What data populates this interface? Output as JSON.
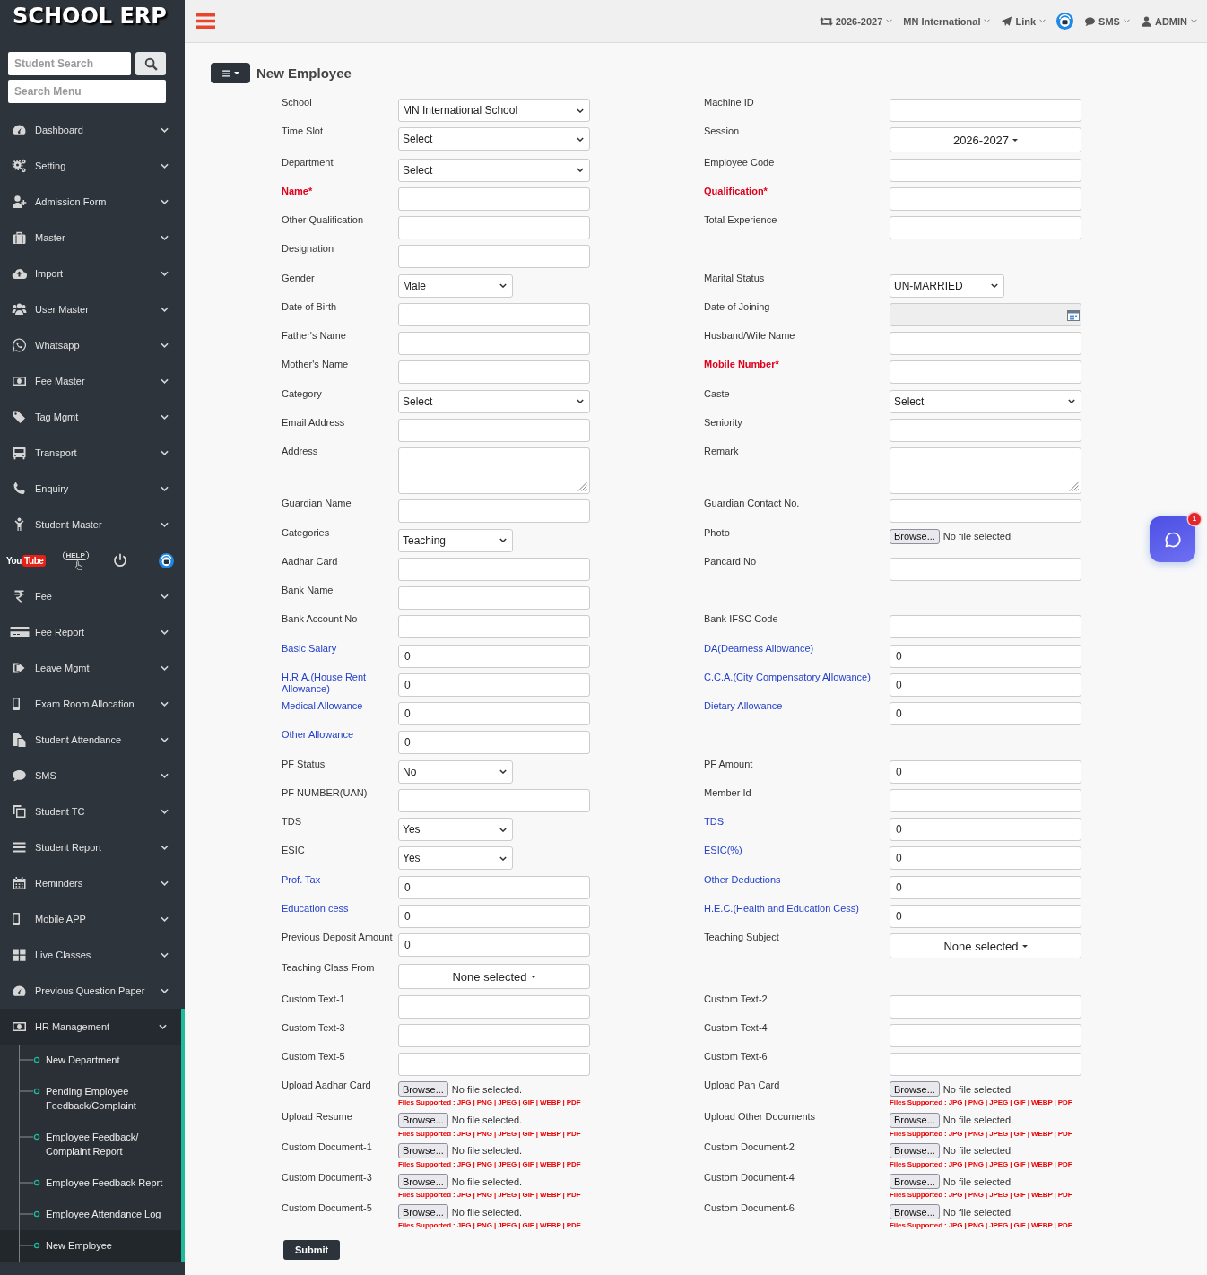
{
  "sidebar": {
    "logo": "SCHOOL ERP",
    "student_search": {
      "placeholder": "Student Search"
    },
    "menu_search": {
      "placeholder": "Search Menu"
    },
    "menu_top": [
      {
        "label": "Dashboard",
        "expanded": false
      },
      {
        "label": "Setting",
        "expanded": false
      },
      {
        "label": "Admission Form",
        "expanded": false
      },
      {
        "label": "Master",
        "expanded": false
      },
      {
        "label": "Import",
        "expanded": false
      },
      {
        "label": "User Master",
        "expanded": false
      },
      {
        "label": "Whatsapp",
        "expanded": false
      },
      {
        "label": "Fee Master",
        "expanded": false
      },
      {
        "label": "Tag Mgmt",
        "expanded": false
      },
      {
        "label": "Transport",
        "expanded": false
      },
      {
        "label": "Enquiry",
        "expanded": false
      },
      {
        "label": "Student Master",
        "expanded": false
      }
    ],
    "quick_links": {
      "youtube": [
        "You",
        "Tube"
      ],
      "help": "HELP"
    },
    "menu_bottom": [
      {
        "label": "Fee",
        "expanded": false
      },
      {
        "label": "Fee Report",
        "expanded": false
      },
      {
        "label": "Leave Mgmt",
        "expanded": false
      },
      {
        "label": "Exam Room Allocation",
        "expanded": false
      },
      {
        "label": "Student Attendance",
        "expanded": false
      },
      {
        "label": "SMS",
        "expanded": false
      },
      {
        "label": "Student TC",
        "expanded": false
      },
      {
        "label": "Student Report",
        "expanded": false
      },
      {
        "label": "Reminders",
        "expanded": false
      },
      {
        "label": "Mobile APP",
        "expanded": false
      },
      {
        "label": "Live Classes",
        "expanded": false
      },
      {
        "label": "Previous Question Paper",
        "expanded": false
      },
      {
        "label": "HR Management",
        "expanded": true,
        "children": [
          {
            "label": "New Department",
            "selected": false
          },
          {
            "label": "Pending Employee Feedback/Complaint",
            "selected": false
          },
          {
            "label": "Employee Feedback/ Complaint Report",
            "selected": false
          },
          {
            "label": "Employee Feedback Reprt",
            "selected": false
          },
          {
            "label": "Employee Attendance Log",
            "selected": false
          },
          {
            "label": "New Employee",
            "selected": true
          }
        ]
      }
    ]
  },
  "topbar": {
    "session": "2026-2027",
    "school": "MN International",
    "link": "Link",
    "sms": "SMS",
    "user": "ADMIN"
  },
  "page": {
    "title": "New Employee"
  },
  "form": {
    "rows": [
      {
        "left": {
          "label": {
            "text": "School",
            "kind": "plain"
          },
          "kind": "select",
          "value": "MN International School"
        },
        "right": {
          "label": {
            "text": "Machine ID",
            "kind": "plain"
          },
          "kind": "text"
        }
      },
      {
        "left": {
          "label": {
            "text": "Time Slot",
            "kind": "plain"
          },
          "kind": "select",
          "value": "Select"
        },
        "right": {
          "label": {
            "text": "Session",
            "kind": "plain"
          },
          "kind": "dropdown",
          "value": "2026-2027"
        }
      },
      {
        "left": {
          "label": {
            "text": "Department",
            "kind": "plain"
          },
          "kind": "select",
          "value": "Select"
        },
        "right": {
          "label": {
            "text": "Employee Code",
            "kind": "plain"
          },
          "kind": "text"
        }
      },
      {
        "left": {
          "label": {
            "text": "Name*",
            "kind": "required"
          },
          "kind": "text"
        },
        "right": {
          "label": {
            "text": "Qualification*",
            "kind": "required"
          },
          "kind": "text"
        }
      },
      {
        "left": {
          "label": {
            "text": "Other Qualification",
            "kind": "plain"
          },
          "kind": "text"
        },
        "right": {
          "label": {
            "text": "Total Experience",
            "kind": "plain"
          },
          "kind": "text"
        }
      },
      {
        "left": {
          "label": {
            "text": "Designation",
            "kind": "plain"
          },
          "kind": "text"
        }
      },
      {
        "left": {
          "label": {
            "text": "Gender",
            "kind": "plain"
          },
          "kind": "short-select",
          "value": "Male"
        },
        "right": {
          "label": {
            "text": "Marital Status",
            "kind": "plain"
          },
          "kind": "short-select",
          "value": "UN-MARRIED"
        }
      },
      {
        "left": {
          "label": {
            "text": "Date of Birth",
            "kind": "plain"
          },
          "kind": "text"
        },
        "right": {
          "label": {
            "text": "Date of Joining",
            "kind": "plain"
          },
          "kind": "date"
        }
      },
      {
        "left": {
          "label": {
            "text": "Father's Name",
            "kind": "plain"
          },
          "kind": "text"
        },
        "right": {
          "label": {
            "text": "Husband/Wife Name",
            "kind": "plain"
          },
          "kind": "text"
        }
      },
      {
        "left": {
          "label": {
            "text": "Mother's Name",
            "kind": "plain"
          },
          "kind": "text"
        },
        "right": {
          "label": {
            "text": "Mobile Number*",
            "kind": "required"
          },
          "kind": "text"
        }
      },
      {
        "left": {
          "label": {
            "text": "Category",
            "kind": "plain"
          },
          "kind": "select",
          "value": "Select"
        },
        "right": {
          "label": {
            "text": "Caste",
            "kind": "plain"
          },
          "kind": "select",
          "value": "Select"
        }
      },
      {
        "left": {
          "label": {
            "text": "Email Address",
            "kind": "plain"
          },
          "kind": "text"
        },
        "right": {
          "label": {
            "text": "Seniority",
            "kind": "plain"
          },
          "kind": "text"
        }
      },
      {
        "left": {
          "label": {
            "text": "Address",
            "kind": "plain"
          },
          "kind": "textarea"
        },
        "right": {
          "label": {
            "text": "Remark",
            "kind": "plain"
          },
          "kind": "textarea"
        }
      },
      {
        "left": {
          "label": {
            "text": "Guardian Name",
            "kind": "plain"
          },
          "kind": "text"
        },
        "right": {
          "label": {
            "text": "Guardian Contact No.",
            "kind": "plain"
          },
          "kind": "text"
        }
      },
      {
        "left": {
          "label": {
            "text": "Categories",
            "kind": "plain"
          },
          "kind": "short-select",
          "value": "Teaching"
        },
        "right": {
          "label": {
            "text": "Photo",
            "kind": "plain"
          },
          "kind": "file",
          "button": "Browse...",
          "status": "No file selected."
        }
      },
      {
        "left": {
          "label": {
            "text": "Aadhar Card",
            "kind": "plain"
          },
          "kind": "text"
        },
        "right": {
          "label": {
            "text": "Pancard No",
            "kind": "plain"
          },
          "kind": "text"
        }
      },
      {
        "left": {
          "label": {
            "text": "Bank Name",
            "kind": "plain"
          },
          "kind": "text"
        }
      },
      {
        "left": {
          "label": {
            "text": "Bank Account No",
            "kind": "plain"
          },
          "kind": "text"
        },
        "right": {
          "label": {
            "text": "Bank IFSC Code",
            "kind": "plain"
          },
          "kind": "text"
        }
      },
      {
        "left": {
          "label": {
            "text": "Basic Salary",
            "kind": "highlight"
          },
          "kind": "text",
          "value": "0"
        },
        "right": {
          "label": {
            "text": "DA(Dearness Allowance)",
            "kind": "highlight"
          },
          "kind": "text",
          "value": "0"
        }
      },
      {
        "left": {
          "label": {
            "text": "H.R.A.(House Rent Allowance)",
            "kind": "highlight"
          },
          "kind": "text",
          "value": "0"
        },
        "right": {
          "label": {
            "text": "C.C.A.(City Compensatory Allowance)",
            "kind": "highlight"
          },
          "kind": "text",
          "value": "0"
        }
      },
      {
        "left": {
          "label": {
            "text": "Medical Allowance",
            "kind": "highlight"
          },
          "kind": "text",
          "value": "0"
        },
        "right": {
          "label": {
            "text": "Dietary Allowance",
            "kind": "highlight"
          },
          "kind": "text",
          "value": "0"
        }
      },
      {
        "left": {
          "label": {
            "text": "Other Allowance",
            "kind": "highlight"
          },
          "kind": "text",
          "value": "0"
        }
      },
      {
        "left": {
          "label": {
            "text": "PF Status",
            "kind": "plain"
          },
          "kind": "short-select",
          "value": "No"
        },
        "right": {
          "label": {
            "text": "PF Amount",
            "kind": "plain"
          },
          "kind": "text",
          "value": "0"
        }
      },
      {
        "left": {
          "label": {
            "text": "PF NUMBER(UAN)",
            "kind": "plain"
          },
          "kind": "text"
        },
        "right": {
          "label": {
            "text": "Member Id",
            "kind": "plain"
          },
          "kind": "text"
        }
      },
      {
        "left": {
          "label": {
            "text": "TDS",
            "kind": "plain"
          },
          "kind": "short-select",
          "value": "Yes"
        },
        "right": {
          "label": {
            "text": "TDS",
            "kind": "highlight"
          },
          "kind": "text",
          "value": "0"
        }
      },
      {
        "left": {
          "label": {
            "text": "ESIC",
            "kind": "plain"
          },
          "kind": "short-select",
          "value": "Yes"
        },
        "right": {
          "label": {
            "text": "ESIC(%)",
            "kind": "highlight"
          },
          "kind": "text",
          "value": "0"
        }
      },
      {
        "left": {
          "label": {
            "text": "Prof. Tax",
            "kind": "highlight"
          },
          "kind": "text",
          "value": "0"
        },
        "right": {
          "label": {
            "text": "Other Deductions",
            "kind": "highlight"
          },
          "kind": "text",
          "value": "0"
        }
      },
      {
        "left": {
          "label": {
            "text": "Education cess",
            "kind": "highlight"
          },
          "kind": "text",
          "value": "0"
        },
        "right": {
          "label": {
            "text": "H.E.C.(Health and Education Cess)",
            "kind": "highlight"
          },
          "kind": "text",
          "value": "0"
        }
      },
      {
        "left": {
          "label": {
            "text": "Previous Deposit Amount",
            "kind": "plain"
          },
          "kind": "text",
          "value": "0"
        },
        "right": {
          "label": {
            "text": "Teaching Subject",
            "kind": "plain"
          },
          "kind": "dropdown",
          "value": "None selected"
        }
      },
      {
        "left": {
          "label": {
            "text": "Teaching Class From",
            "kind": "plain"
          },
          "kind": "dropdown",
          "value": "None selected"
        }
      },
      {
        "left": {
          "label": {
            "text": "Custom Text-1",
            "kind": "plain"
          },
          "kind": "text"
        },
        "right": {
          "label": {
            "text": "Custom Text-2",
            "kind": "plain"
          },
          "kind": "text"
        }
      },
      {
        "left": {
          "label": {
            "text": "Custom Text-3",
            "kind": "plain"
          },
          "kind": "text"
        },
        "right": {
          "label": {
            "text": "Custom Text-4",
            "kind": "plain"
          },
          "kind": "text"
        }
      },
      {
        "left": {
          "label": {
            "text": "Custom Text-5",
            "kind": "plain"
          },
          "kind": "text"
        },
        "right": {
          "label": {
            "text": "Custom Text-6",
            "kind": "plain"
          },
          "kind": "text"
        }
      },
      {
        "left": {
          "label": {
            "text": "Upload Aadhar Card",
            "kind": "plain"
          },
          "kind": "file",
          "button": "Browse...",
          "status": "No file selected.",
          "hint": "Files Supported : JPG | PNG | JPEG | GIF | WEBP | PDF"
        },
        "right": {
          "label": {
            "text": "Upload Pan Card",
            "kind": "plain"
          },
          "kind": "file",
          "button": "Browse...",
          "status": "No file selected.",
          "hint": "Files Supported : JPG | PNG | JPEG | GIF | WEBP | PDF"
        }
      },
      {
        "left": {
          "label": {
            "text": "Upload Resume",
            "kind": "plain"
          },
          "kind": "file",
          "button": "Browse...",
          "status": "No file selected.",
          "hint": "Files Supported : JPG | PNG | JPEG | GIF | WEBP | PDF"
        },
        "right": {
          "label": {
            "text": "Upload Other Documents",
            "kind": "plain"
          },
          "kind": "file",
          "button": "Browse...",
          "status": "No file selected.",
          "hint": "Files Supported : JPG | PNG | JPEG | GIF | WEBP | PDF"
        }
      },
      {
        "left": {
          "label": {
            "text": "Custom Document-1",
            "kind": "plain"
          },
          "kind": "file",
          "button": "Browse...",
          "status": "No file selected.",
          "hint": "Files Supported : JPG | PNG | JPEG | GIF | WEBP | PDF"
        },
        "right": {
          "label": {
            "text": "Custom Document-2",
            "kind": "plain"
          },
          "kind": "file",
          "button": "Browse...",
          "status": "No file selected.",
          "hint": "Files Supported : JPG | PNG | JPEG | GIF | WEBP | PDF"
        }
      },
      {
        "left": {
          "label": {
            "text": "Custom Document-3",
            "kind": "plain"
          },
          "kind": "file",
          "button": "Browse...",
          "status": "No file selected.",
          "hint": "Files Supported : JPG | PNG | JPEG | GIF | WEBP | PDF"
        },
        "right": {
          "label": {
            "text": "Custom Document-4",
            "kind": "plain"
          },
          "kind": "file",
          "button": "Browse...",
          "status": "No file selected.",
          "hint": "Files Supported : JPG | PNG | JPEG | GIF | WEBP | PDF"
        }
      },
      {
        "left": {
          "label": {
            "text": "Custom Document-5",
            "kind": "plain"
          },
          "kind": "file",
          "button": "Browse...",
          "status": "No file selected.",
          "hint": "Files Supported : JPG | PNG | JPEG | GIF | WEBP | PDF"
        },
        "right": {
          "label": {
            "text": "Custom Document-6",
            "kind": "plain"
          },
          "kind": "file",
          "button": "Browse...",
          "status": "No file selected.",
          "hint": "Files Supported : JPG | PNG | JPEG | GIF | WEBP | PDF"
        }
      }
    ],
    "submit": "Submit"
  },
  "chat": {
    "badge": "1"
  }
}
